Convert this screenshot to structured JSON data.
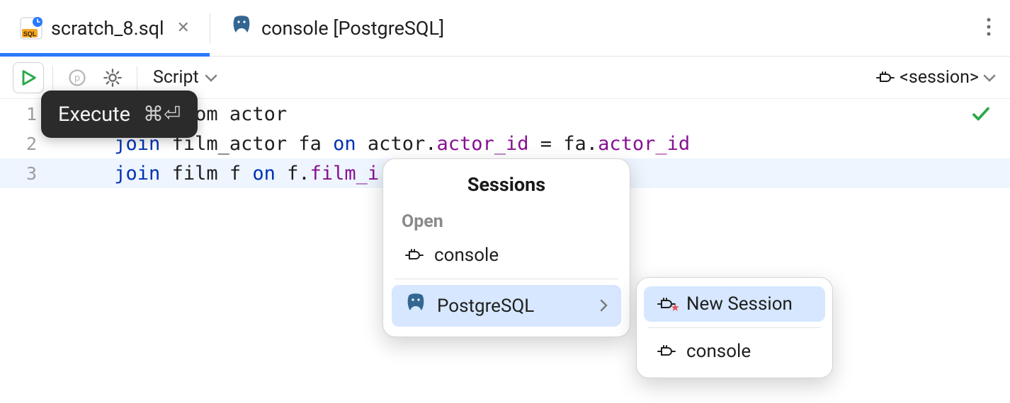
{
  "tabs": {
    "active": {
      "label": "scratch_8.sql"
    },
    "other": {
      "label": "console [PostgreSQL]"
    }
  },
  "toolbar": {
    "script_label": "Script",
    "session_label": "<session>"
  },
  "tooltip": {
    "label": "Execute",
    "shortcut": "⌘⏎"
  },
  "editor": {
    "lines": [
      {
        "n": "1",
        "segments": [
          {
            "t": "            ",
            "c": "txt"
          },
          {
            "t": "om ",
            "c": "txt"
          },
          {
            "t": "actor",
            "c": "txt"
          }
        ]
      },
      {
        "n": "2",
        "segments": [
          {
            "t": "     ",
            "c": "txt"
          },
          {
            "t": "join",
            "c": "kw"
          },
          {
            "t": " film_actor fa ",
            "c": "txt"
          },
          {
            "t": "on",
            "c": "kw"
          },
          {
            "t": " actor",
            "c": "txt"
          },
          {
            "t": ".",
            "c": "txt"
          },
          {
            "t": "actor_id",
            "c": "ident"
          },
          {
            "t": " = fa.",
            "c": "txt"
          },
          {
            "t": "actor_id",
            "c": "ident"
          }
        ]
      },
      {
        "n": "3",
        "segments": [
          {
            "t": "     ",
            "c": "txt"
          },
          {
            "t": "join",
            "c": "kw"
          },
          {
            "t": " film f ",
            "c": "txt"
          },
          {
            "t": "on",
            "c": "kw"
          },
          {
            "t": " f.",
            "c": "txt"
          },
          {
            "t": "film_i",
            "c": "ident"
          }
        ]
      }
    ]
  },
  "sessions_popup": {
    "title": "Sessions",
    "open_label": "Open",
    "items": {
      "console": "console",
      "postgres": "PostgreSQL"
    }
  },
  "sessions_submenu": {
    "new_session": "New Session",
    "console": "console"
  }
}
